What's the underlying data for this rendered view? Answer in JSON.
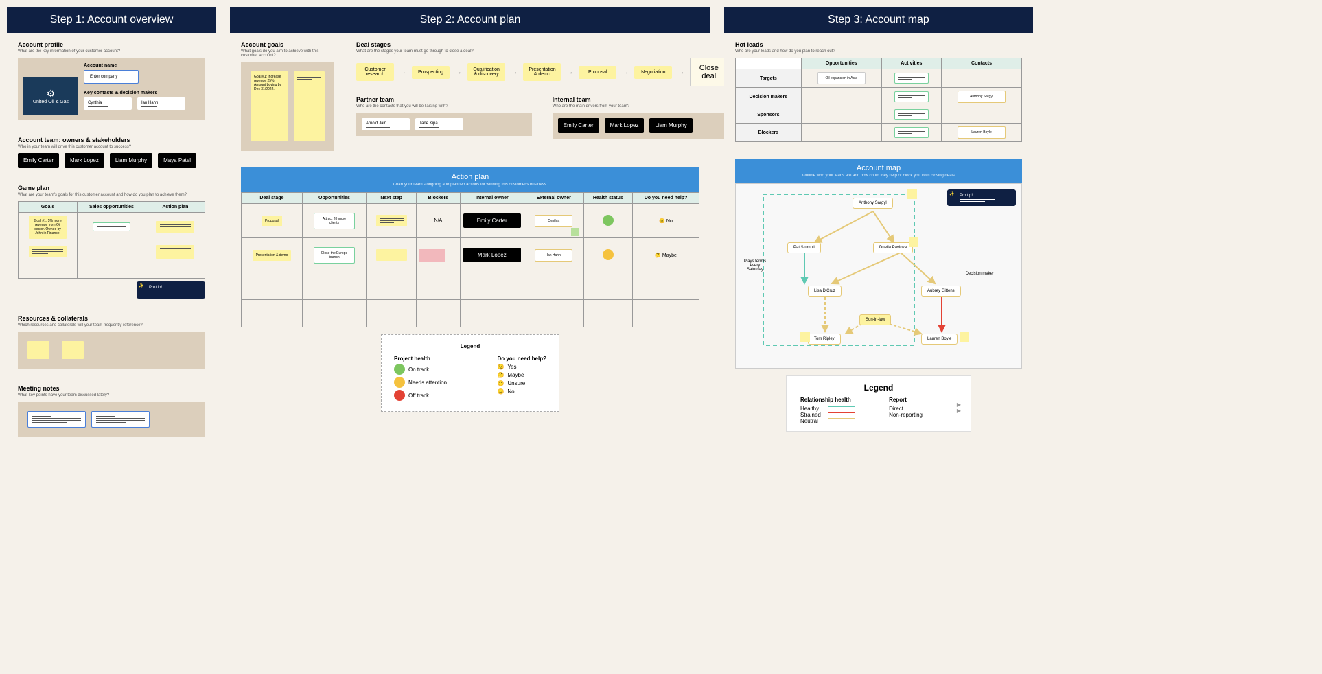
{
  "steps": {
    "s1": "Step 1: Account overview",
    "s2": "Step 2: Account plan",
    "s3": "Step 3: Account map"
  },
  "s1": {
    "profile": {
      "title": "Account profile",
      "sub": "What are the key information of your customer account?",
      "name_label": "Account name",
      "name_val": "Enter company",
      "contacts_label": "Key contacts & decision makers",
      "logo": "United Oil & Gas",
      "c1": "Cynthia",
      "c2": "Ian Hahn"
    },
    "team": {
      "title": "Account team: owners & stakeholders",
      "sub": "Who in your team will drive this customer account to success?",
      "members": [
        "Emily Carter",
        "Mark Lopez",
        "Liam Murphy",
        "Maya Patel"
      ]
    },
    "gameplan": {
      "title": "Game plan",
      "sub": "What are your team's goals for this customer account and how do you plan to achieve them?",
      "cols": [
        "Goals",
        "Sales opportunities",
        "Action plan"
      ],
      "goal1": "Goal #1:\n5% more revenue from Oil sector. Owned by John in Finance."
    },
    "resources": {
      "title": "Resources & collaterals",
      "sub": "Which resources and collaterals will your team frequently reference?"
    },
    "meeting": {
      "title": "Meeting notes",
      "sub": "What key points have your team discussed lately?"
    },
    "protip": "Pro tip!"
  },
  "s2": {
    "goals": {
      "title": "Account goals",
      "sub": "What goals do you aim to achieve with this customer account?",
      "g1": "Goal #1:\nIncrease revenue 25%. Amount buying by Dec 31/2022."
    },
    "stages": {
      "title": "Deal stages",
      "sub": "What are the stages your team must go through to close a deal?",
      "list": [
        "Customer research",
        "Prospecting",
        "Qualification & discovery",
        "Presentation & demo",
        "Proposal",
        "Negotiation",
        "Close deal"
      ]
    },
    "partner": {
      "title": "Partner team",
      "sub": "Who are the contacts that you will be liaising with?",
      "p1": "Arnold Jain",
      "p2": "Tane Kipa"
    },
    "internal": {
      "title": "Internal team",
      "sub": "Who are the main drivers from your team?",
      "members": [
        "Emily Carter",
        "Mark Lopez",
        "Liam Murphy"
      ]
    },
    "action": {
      "title": "Action plan",
      "sub": "Chart your team's ongoing and planned actions for winning this customer's business.",
      "cols": [
        "Deal stage",
        "Opportunities",
        "Next step",
        "Blockers",
        "Internal owner",
        "External owner",
        "Health status",
        "Do you need help?"
      ],
      "r1": {
        "stage": "Proposal",
        "opp": "Attract 20 more clients",
        "owner": "Emily Carter",
        "na": "N/A",
        "ext": "Cynthia",
        "help": "😐 No"
      },
      "r2": {
        "stage": "Presentation & demo",
        "opp": "Close the Europe branch",
        "owner": "Mark Lopez",
        "ext": "Ian Hahn",
        "help": "🤔 Maybe"
      }
    },
    "legend": {
      "title": "Legend",
      "ph": "Project health",
      "help": "Do you need help?",
      "h1": "On track",
      "h2": "Needs attention",
      "h3": "Off track",
      "y1": "Yes",
      "y2": "Maybe",
      "y3": "Unsure",
      "y4": "No"
    }
  },
  "s3": {
    "hot": {
      "title": "Hot leads",
      "sub": "Who are your leads and how do you plan to reach out?",
      "cols": [
        "",
        "Opportunities",
        "Activities",
        "Contacts"
      ],
      "rows": [
        "Targets",
        "Decision makers",
        "Sponsors",
        "Blockers"
      ],
      "opp": "Oil expansion in Asia",
      "c_dm": "Anthony Sargyl",
      "c_bl": "Lauren Boyle"
    },
    "map": {
      "title": "Account map",
      "sub": "Outline who your leads are and how could they help or block you from closing deals",
      "nodes": {
        "anthony": "Anthony Sargyl",
        "pat": "Pat Stumuli",
        "duelle": "Duella Pavlova",
        "lisa": "Lisa D'Cruz",
        "aubrey": "Aubrey Gittens",
        "tom": "Tom Ripley",
        "son": "Son-in-law",
        "lauren": "Lauren Boyle",
        "tennis": "Plays tennis every Saturday",
        "dm": "Decision maker"
      },
      "protip": "Pro tip!"
    },
    "legend": {
      "title": "Legend",
      "rel": "Relationship health",
      "rep": "Report",
      "h": "Healthy",
      "s": "Strained",
      "n": "Neutral",
      "d": "Direct",
      "nr": "Non-reporting"
    }
  }
}
